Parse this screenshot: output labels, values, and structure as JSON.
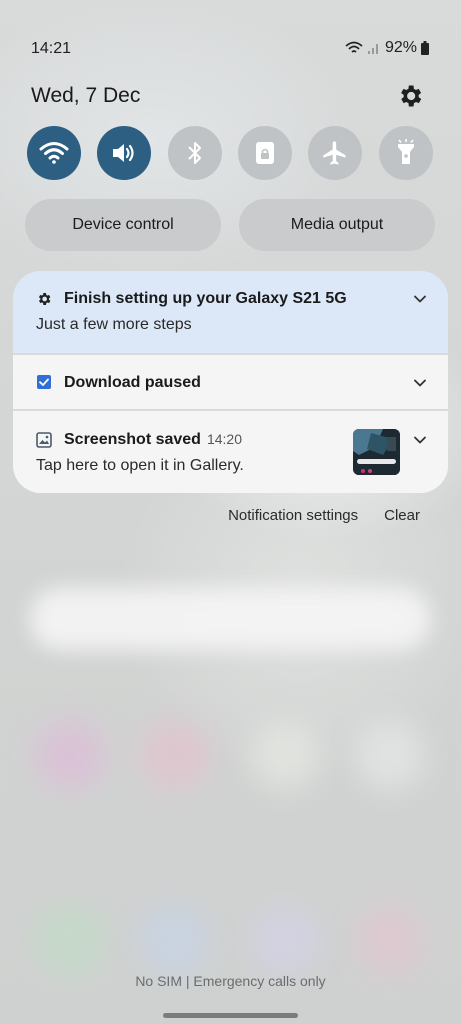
{
  "status_bar": {
    "time": "14:21",
    "battery": "92%",
    "icons": [
      "wifi-icon",
      "signal-icon",
      "battery-icon"
    ]
  },
  "header": {
    "date": "Wed, 7 Dec",
    "settings_icon": "gear-icon"
  },
  "quick_settings": [
    {
      "name": "wifi",
      "icon": "wifi-icon",
      "active": true
    },
    {
      "name": "sound",
      "icon": "speaker-icon",
      "active": true
    },
    {
      "name": "bluetooth",
      "icon": "bluetooth-icon",
      "active": false
    },
    {
      "name": "rotation-lock",
      "icon": "lock-icon",
      "active": false
    },
    {
      "name": "airplane-mode",
      "icon": "airplane-icon",
      "active": false
    },
    {
      "name": "flashlight",
      "icon": "flashlight-icon",
      "active": false
    }
  ],
  "buttons": {
    "device_control": "Device control",
    "media_output": "Media output"
  },
  "notifications": [
    {
      "icon": "gear-icon",
      "title": "Finish setting up your Galaxy S21 5G",
      "subtitle": "Just a few more steps"
    },
    {
      "icon": "checkbox-icon",
      "title": "Download paused"
    },
    {
      "icon": "gallery-icon",
      "title": "Screenshot saved",
      "time": "14:20",
      "subtitle": "Tap here to open it in Gallery."
    }
  ],
  "actions": {
    "notification_settings": "Notification settings",
    "clear": "Clear"
  },
  "footer": {
    "status": "No SIM | Emergency calls only"
  },
  "colors": {
    "tile_active": "#2c5f82",
    "tile_inactive": "#bfc3c5",
    "highlight_notification": "#dce8f8"
  }
}
